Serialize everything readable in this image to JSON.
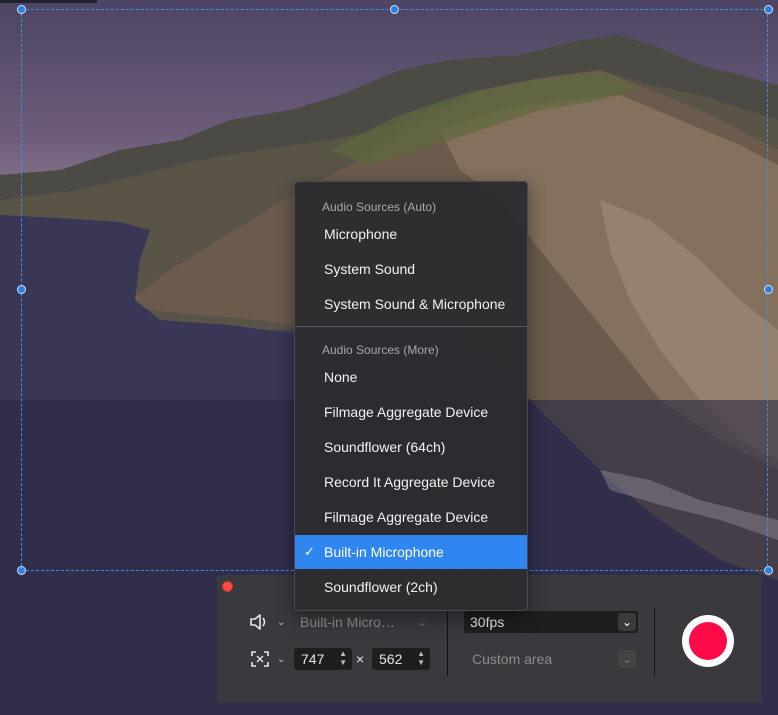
{
  "menu": {
    "header_auto": "Audio Sources (Auto)",
    "auto_items": [
      "Microphone",
      "System Sound",
      "System Sound & Microphone"
    ],
    "header_more": "Audio Sources (More)",
    "more_items": [
      "None",
      "Filmage Aggregate Device",
      "Soundflower (64ch)",
      "Record It Aggregate Device",
      "Filmage Aggregate Device",
      "Built-in Microphone",
      "Soundflower (2ch)"
    ],
    "selected_item": "Built-in Microphone"
  },
  "controls": {
    "audio_source_value": "Built-in Micro…",
    "width": "747",
    "height": "562",
    "times_symbol": "×",
    "fps": "30fps",
    "area_mode": "Custom area"
  },
  "icons": {
    "speaker": "speaker-icon",
    "resize": "resize-frame-icon",
    "check": "check-icon",
    "chevron": "chevron-down-icon"
  },
  "colors": {
    "selection_border": "#3b8fe5",
    "highlight": "#2f86f0",
    "record": "#ff0a48",
    "close": "#ff4a4a"
  }
}
